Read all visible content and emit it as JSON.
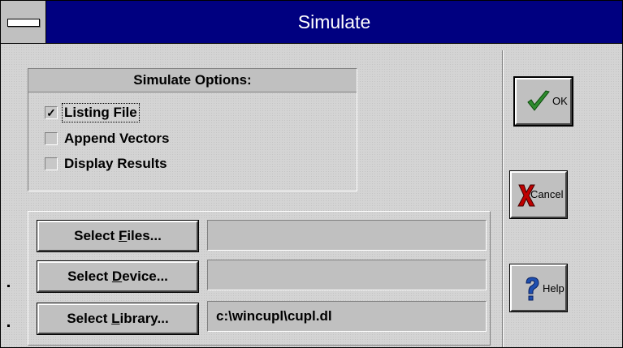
{
  "window": {
    "title": "Simulate"
  },
  "options": {
    "header": "Simulate Options:",
    "items": [
      {
        "label": "Listing File",
        "checked": true,
        "check_mark": "✓"
      },
      {
        "label": "Append Vectors",
        "checked": false,
        "check_mark": ""
      },
      {
        "label": "Display Results",
        "checked": false,
        "check_mark": ""
      }
    ]
  },
  "selectors": [
    {
      "button_pre": "Select ",
      "button_key": "F",
      "button_post": "iles...",
      "value": ""
    },
    {
      "button_pre": "Select ",
      "button_key": "D",
      "button_post": "evice...",
      "value": ""
    },
    {
      "button_pre": "Select ",
      "button_key": "L",
      "button_post": "ibrary...",
      "value": "c:\\wincupl\\cupl.dl"
    }
  ],
  "buttons": {
    "ok_label": "OK",
    "cancel_label": "Cancel",
    "help_label": "Help"
  },
  "icons": {
    "system_menu": "system-menu-icon",
    "ok": "checkmark-icon",
    "cancel": "x-icon",
    "help": "question-mark-icon"
  },
  "colors": {
    "titlebar": "#000080",
    "face": "#c0c0c0",
    "ok_icon": "#2e8b2e",
    "cancel_icon": "#c00000",
    "help_icon": "#1e4fb0"
  }
}
